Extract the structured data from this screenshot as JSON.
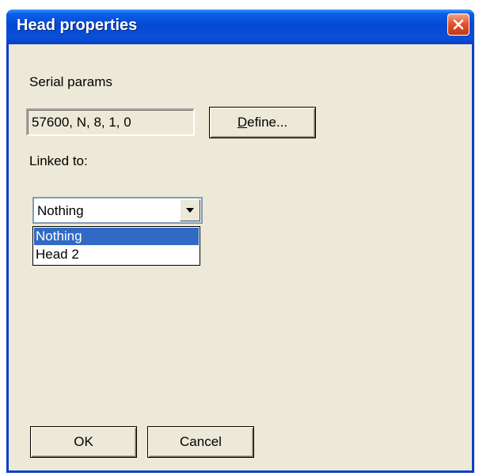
{
  "window": {
    "title": "Head properties",
    "close_label": "Close"
  },
  "serial": {
    "label": "Serial params",
    "value": "57600, N, 8, 1, 0",
    "define_button_prefix": "D",
    "define_button_rest": "efine..."
  },
  "linked": {
    "label": "Linked to:",
    "selected_value": "Nothing",
    "options": [
      "Nothing",
      "Head 2"
    ]
  },
  "buttons": {
    "ok": "OK",
    "cancel": "Cancel"
  },
  "colors": {
    "titlebar": "#0548d4",
    "dialog_bg": "#ece9d8",
    "selection": "#316ac5",
    "close_button": "#e2552f"
  }
}
